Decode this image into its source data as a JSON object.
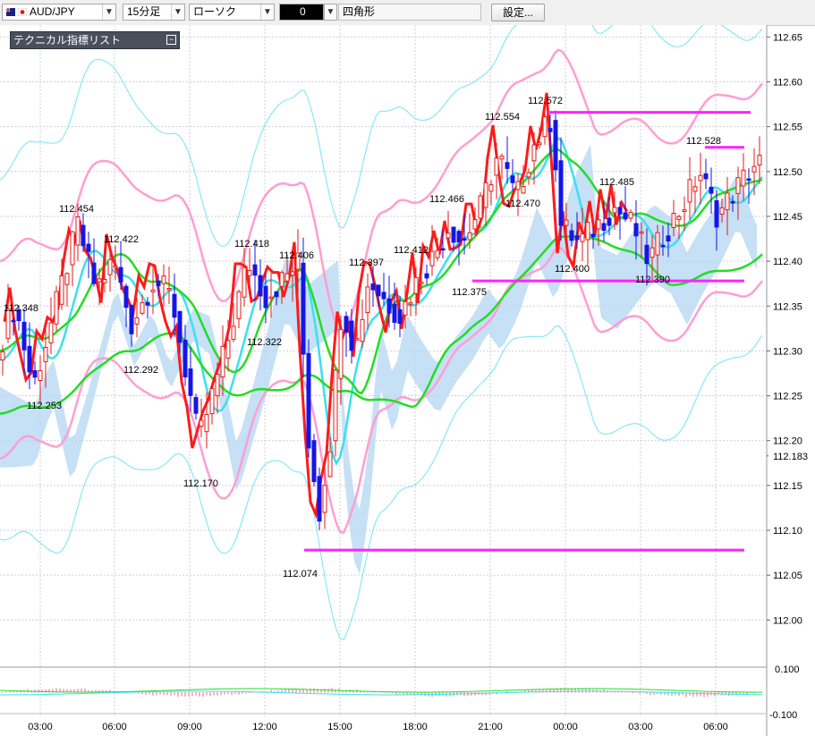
{
  "toolbar": {
    "symbol": "AUD/JPY",
    "timeframe": "15分足",
    "chart_style": "ローソク",
    "color_swatch_label": "0",
    "drawing_tool": "四角形",
    "settings_button": "設定..."
  },
  "indicator_panel": {
    "title": "テクニカル指標リスト"
  },
  "colors": {
    "bull_candle": "#e31a1a",
    "bear_candle": "#1515e8",
    "price_line": "#ff1a1a",
    "bollinger_outer": "#6ee7f5",
    "bollinger_inner": "#ff9ed2",
    "ma_green": "#22dd22",
    "ma_cyan": "#3ae0f0",
    "cloud": "#b8d8f4",
    "support_line": "#ff22ff"
  },
  "chart_data": {
    "type": "candlestick",
    "y_axis_labels": [
      "112.65",
      "112.60",
      "112.55",
      "112.50",
      "112.45",
      "112.40",
      "112.35",
      "112.30",
      "112.25",
      "112.20",
      "112.183",
      "112.15",
      "112.10",
      "112.05",
      "112.00"
    ],
    "x_axis_labels": [
      "03:00",
      "06:00",
      "09:00",
      "12:00",
      "15:00",
      "18:00",
      "21:00",
      "00:00",
      "03:00",
      "06:00"
    ],
    "current_price": "112.183",
    "price_annotations": [
      {
        "label": "112.454",
        "value": 112.454
      },
      {
        "label": "112.422",
        "value": 112.422
      },
      {
        "label": "112.348",
        "value": 112.348
      },
      {
        "label": "112.292",
        "value": 112.292
      },
      {
        "label": "112.253",
        "value": 112.253
      },
      {
        "label": "112.170",
        "value": 112.17
      },
      {
        "label": "112.418",
        "value": 112.418
      },
      {
        "label": "112.406",
        "value": 112.406
      },
      {
        "label": "112.322",
        "value": 112.322
      },
      {
        "label": "112.397",
        "value": 112.397
      },
      {
        "label": "112.412",
        "value": 112.412
      },
      {
        "label": "112.466",
        "value": 112.466
      },
      {
        "label": "112.375",
        "value": 112.375
      },
      {
        "label": "112.554",
        "value": 112.554
      },
      {
        "label": "112.572",
        "value": 112.572
      },
      {
        "label": "112.470",
        "value": 112.47
      },
      {
        "label": "112.485",
        "value": 112.485
      },
      {
        "label": "112.400",
        "value": 112.4
      },
      {
        "label": "112.390",
        "value": 112.39
      },
      {
        "label": "112.528",
        "value": 112.528
      },
      {
        "label": "112.074",
        "value": 112.074
      }
    ],
    "oscillator_axis_labels": [
      "0.100",
      "-0.100"
    ],
    "grid": true
  }
}
